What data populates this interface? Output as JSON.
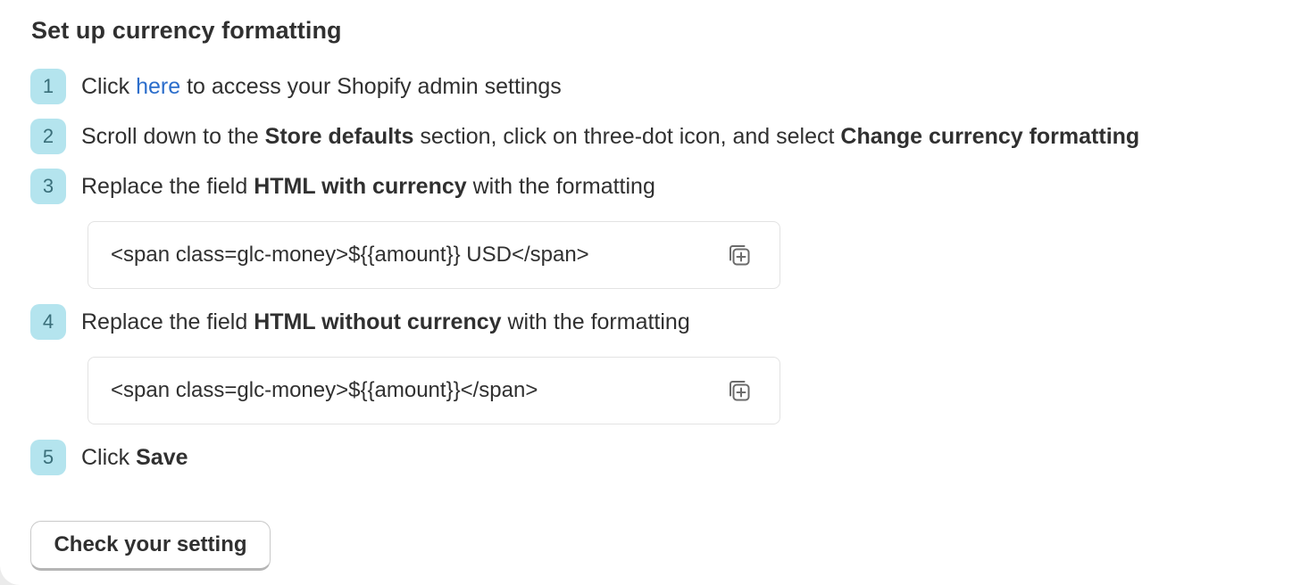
{
  "title": "Set up currency formatting",
  "steps": [
    {
      "number": "1",
      "parts": [
        "Click ",
        "here",
        " to access your Shopify admin settings"
      ]
    },
    {
      "number": "2",
      "parts": [
        "Scroll down to the ",
        "Store defaults",
        " section, click on three-dot icon, and select ",
        "Change currency formatting"
      ]
    },
    {
      "number": "3",
      "parts": [
        "Replace the field ",
        "HTML with currency",
        " with the formatting"
      ]
    },
    {
      "number": "4",
      "parts": [
        "Replace the field ",
        "HTML without currency",
        " with the formatting"
      ]
    },
    {
      "number": "5",
      "parts": [
        "Click ",
        "Save"
      ]
    }
  ],
  "code_with_currency": "<span class=glc-money>${{amount}} USD</span>",
  "code_without_currency": "<span class=glc-money>${{amount}}</span>",
  "copy_icon": "copy-icon",
  "check_button_label": "Check your setting",
  "colors": {
    "badge_bg": "#b4e4ee",
    "link": "#2c6ecb",
    "text": "#303030"
  }
}
